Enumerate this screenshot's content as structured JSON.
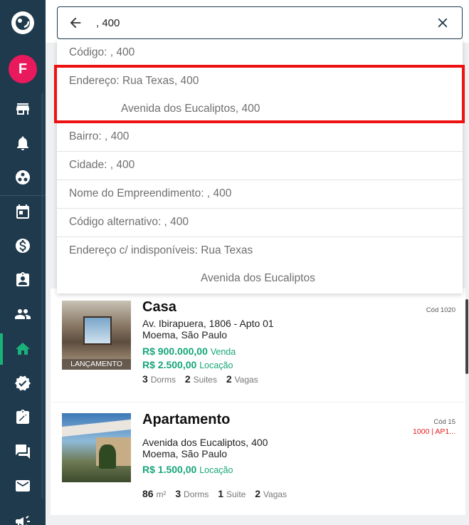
{
  "sidebar": {
    "avatar_letter": "F",
    "items": [
      {
        "icon": "store-icon"
      },
      {
        "icon": "bell-icon"
      },
      {
        "icon": "community-icon"
      },
      {
        "icon": "calendar-icon"
      },
      {
        "icon": "dollar-icon"
      },
      {
        "icon": "clipboard-user-icon"
      },
      {
        "icon": "people-icon"
      },
      {
        "icon": "home-icon",
        "active": true
      },
      {
        "icon": "verified-icon"
      },
      {
        "icon": "edit-note-icon"
      },
      {
        "icon": "chat-icon"
      },
      {
        "icon": "mail-icon"
      },
      {
        "icon": "megaphone-icon"
      }
    ],
    "accent": "#19b37a",
    "background": "#1f3a4d"
  },
  "search": {
    "value": ", 400"
  },
  "suggestions": [
    {
      "line1": "Código: , 400"
    },
    {
      "line1": "Endereço: Rua Texas, 400",
      "line2": "Avenida dos Eucaliptos, 400",
      "highlighted": true
    },
    {
      "line1": "Bairro: , 400"
    },
    {
      "line1": "Cidade: , 400"
    },
    {
      "line1": "Nome do Empreendimento: , 400"
    },
    {
      "line1": "Código alternativo: , 400"
    },
    {
      "line1": "Endereço c/ indisponíveis: Rua Texas",
      "line2": "Avenida dos Eucaliptos"
    }
  ],
  "listings": [
    {
      "title": "Casa",
      "code": "Cód 1020",
      "address": "Av. Ibirapuera, 1806 - Apto 01",
      "area": "Moema, São Paulo",
      "badge": "LANÇAMENTO",
      "prices": [
        {
          "value": "R$ 900.000,00",
          "kind": "Venda"
        },
        {
          "value": "R$ 2.500,00",
          "kind": "Locação"
        }
      ],
      "features": [
        {
          "n": "3",
          "u": "Dorms"
        },
        {
          "n": "2",
          "u": "Suites"
        },
        {
          "n": "2",
          "u": "Vagas"
        }
      ]
    },
    {
      "title": "Apartamento",
      "code": "Cód 15",
      "code2": "1000 | AP1...",
      "address": "Avenida dos Eucaliptos, 400",
      "area": "Moema, São Paulo",
      "prices": [
        {
          "value": "R$ 1.500,00",
          "kind": "Locação"
        }
      ],
      "features": [
        {
          "n": "86",
          "u": "m²"
        },
        {
          "n": "3",
          "u": "Dorms"
        },
        {
          "n": "1",
          "u": "Suite"
        },
        {
          "n": "2",
          "u": "Vagas"
        }
      ]
    }
  ],
  "colors": {
    "price_green": "#15a679",
    "highlight_red": "#ee1111",
    "code_red": "#e31b1b",
    "avatar_pink": "#e8195c"
  }
}
